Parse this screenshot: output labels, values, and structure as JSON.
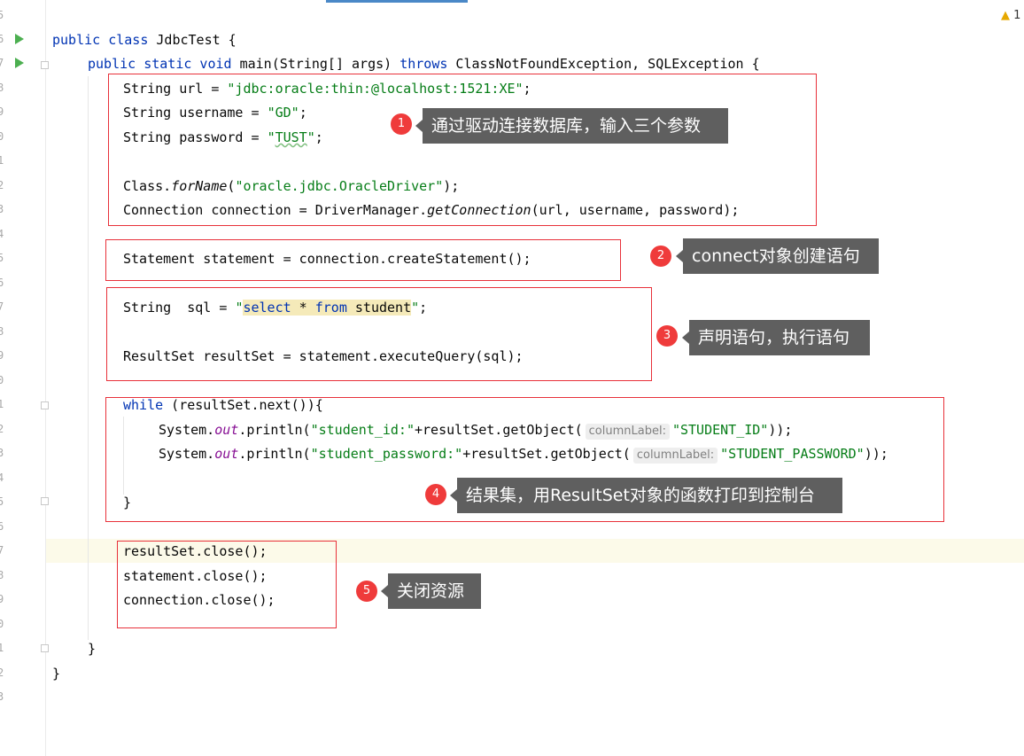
{
  "warning": {
    "icon": "warning-triangle-icon",
    "count": "1"
  },
  "gutter": {
    "numbers": [
      "5",
      "6",
      "7",
      "8",
      "9",
      "0",
      "1",
      "2",
      "3",
      "4",
      "5",
      "6",
      "7",
      "8",
      "9",
      "0",
      "1",
      "2",
      "3",
      "4",
      "5",
      "6",
      "7",
      "8",
      "9",
      "0",
      "1",
      "2",
      "3"
    ]
  },
  "code": {
    "l1": {
      "kw": "public class",
      "rest": " JdbcTest {"
    },
    "l2": {
      "kw": "public static void",
      "name": " main",
      "a": "(String[] args) ",
      "throws": "throws",
      "b": " ClassNotFoundException, SQLException {"
    },
    "l3": {
      "a": "String url = ",
      "s": "\"jdbc:oracle:thin:@localhost:1521:XE\"",
      "b": ";"
    },
    "l4": {
      "a": "String username = ",
      "s": "\"GD\"",
      "b": ";"
    },
    "l5": {
      "a": "String password = ",
      "s1": "\"",
      "s2": "TUST",
      "s3": "\"",
      "b": ";"
    },
    "l6": {
      "a": "Class.",
      "m": "forName",
      "b": "(",
      "s": "\"oracle.jdbc.OracleDriver\"",
      "c": ");"
    },
    "l7": {
      "a": "Connection connection = DriverManager.",
      "m": "getConnection",
      "b": "(url, username, password);"
    },
    "l8": {
      "a": "Statement statement = connection.createStatement();"
    },
    "l9": {
      "a": "String  sql = ",
      "q1": "\"",
      "k1": "select",
      "sp1": " * ",
      "k2": "from",
      "t": " student",
      "q2": "\"",
      "b": ";"
    },
    "l10": {
      "a": "ResultSet resultSet = statement.executeQuery(sql);"
    },
    "l11": {
      "kw": "while",
      "b": " (resultSet.next()){"
    },
    "l12": {
      "a": "System.",
      "f": "out",
      "b": ".println(",
      "s": "\"student_id:\"",
      "c": "+resultSet.getObject(",
      "hint": "columnLabel:",
      "s2": "\"STUDENT_ID\"",
      "d": "));"
    },
    "l13": {
      "a": "System.",
      "f": "out",
      "b": ".println(",
      "s": "\"student_password:\"",
      "c": "+resultSet.getObject(",
      "hint": "columnLabel:",
      "s2": "\"STUDENT_PASSWORD\"",
      "d": "));"
    },
    "l14": {
      "a": "}"
    },
    "l15": {
      "a": "resultSet.close();"
    },
    "l16": {
      "a": "statement.close();"
    },
    "l17": {
      "a": "connection.close();"
    },
    "l18": {
      "a": "}"
    },
    "l19": {
      "a": "}"
    }
  },
  "annotations": [
    {
      "num": "1",
      "text": "通过驱动连接数据库，输入三个参数"
    },
    {
      "num": "2",
      "text": "connect对象创建语句"
    },
    {
      "num": "3",
      "text": "声明语句，执行语句"
    },
    {
      "num": "4",
      "text": "结果集，用ResultSet对象的函数打印到控制台"
    },
    {
      "num": "5",
      "text": "关闭资源"
    }
  ],
  "colors": {
    "keyword": "#0033b3",
    "string": "#067d17",
    "field": "#871094",
    "box": "#e8313a",
    "badge": "#ef3b3b",
    "note_bg": "#5f5f5f"
  }
}
